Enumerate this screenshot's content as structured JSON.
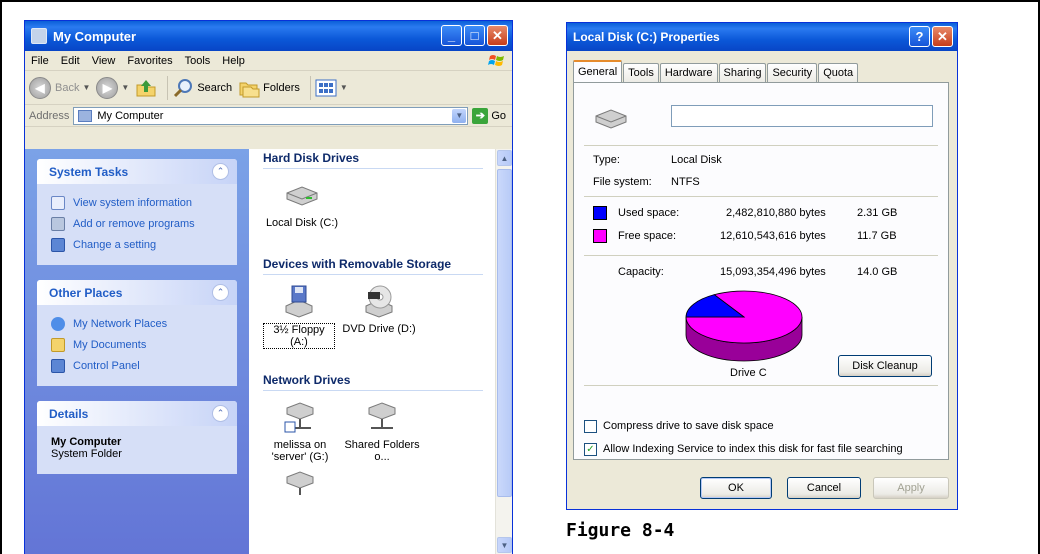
{
  "explorer": {
    "title": "My Computer",
    "menu": [
      "File",
      "Edit",
      "View",
      "Favorites",
      "Tools",
      "Help"
    ],
    "toolbar": {
      "back": "Back",
      "search": "Search",
      "folders": "Folders"
    },
    "address": {
      "label": "Address",
      "value": "My Computer",
      "go": "Go"
    },
    "panels": {
      "system_tasks": {
        "title": "System Tasks",
        "links": [
          "View system information",
          "Add or remove programs",
          "Change a setting"
        ]
      },
      "other_places": {
        "title": "Other Places",
        "links": [
          "My Network Places",
          "My Documents",
          "Control Panel"
        ]
      },
      "details": {
        "title": "Details",
        "name": "My Computer",
        "sub": "System Folder"
      }
    },
    "groups": {
      "hard": {
        "title": "Hard Disk Drives",
        "items": [
          "Local Disk (C:)"
        ]
      },
      "removable": {
        "title": "Devices with Removable Storage",
        "floppy": "3½ Floppy (A:)",
        "dvd": "DVD Drive (D:)"
      },
      "network": {
        "title": "Network Drives",
        "melissa": "melissa on 'server' (G:)",
        "shared": "Shared Folders o..."
      }
    }
  },
  "properties": {
    "title": "Local Disk (C:) Properties",
    "tabs": [
      "General",
      "Tools",
      "Hardware",
      "Sharing",
      "Security",
      "Quota"
    ],
    "type_label": "Type:",
    "type_value": "Local Disk",
    "fs_label": "File system:",
    "fs_value": "NTFS",
    "used": {
      "label": "Used space:",
      "bytes": "2,482,810,880 bytes",
      "size": "2.31 GB",
      "color": "#0000ff"
    },
    "free": {
      "label": "Free space:",
      "bytes": "12,610,543,616 bytes",
      "size": "11.7 GB",
      "color": "#ff00ff"
    },
    "capacity": {
      "label": "Capacity:",
      "bytes": "15,093,354,496 bytes",
      "size": "14.0 GB"
    },
    "drive_label": "Drive C",
    "cleanup": "Disk Cleanup",
    "compress": "Compress drive to save disk space",
    "indexing": "Allow Indexing Service to index this disk for fast file searching",
    "compress_checked": false,
    "indexing_checked": true,
    "ok": "OK",
    "cancel": "Cancel",
    "apply": "Apply",
    "used_fraction": 0.1645
  },
  "caption": "Figure 8-4"
}
